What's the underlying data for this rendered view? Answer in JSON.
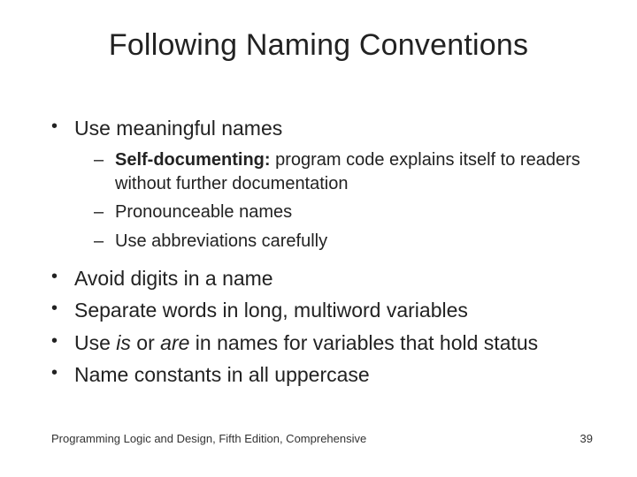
{
  "title": "Following Naming Conventions",
  "bullets1": {
    "b0": "Use meaningful names",
    "sub": {
      "s0_bold": "Self-documenting:",
      "s0_rest": " program code explains itself to readers without further documentation",
      "s1": "Pronounceable names",
      "s2": "Use abbreviations carefully"
    }
  },
  "bullets2": {
    "b0": "Avoid digits in a name",
    "b1": "Separate words in long, multiword variables",
    "b2_pre": "Use ",
    "b2_it1": "is",
    "b2_mid": " or ",
    "b2_it2": "are",
    "b2_post": " in names for variables that hold status",
    "b3": "Name constants in all uppercase"
  },
  "footer": {
    "text": "Programming Logic and Design, Fifth Edition, Comprehensive",
    "page": "39"
  }
}
